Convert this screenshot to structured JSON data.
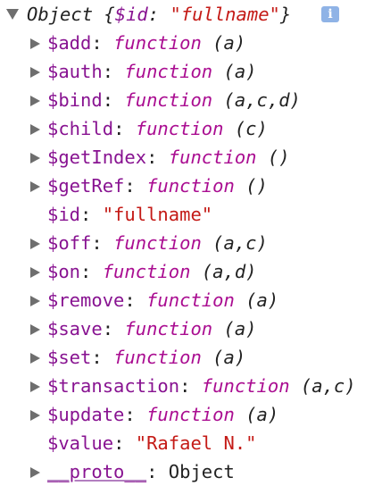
{
  "header": {
    "type_label": "Object",
    "open_brace": "{",
    "preview_key": "$id",
    "preview_sep": ": ",
    "preview_value": "\"fullname\"",
    "close_brace": "}",
    "info_icon": "i"
  },
  "properties": [
    {
      "key": "$add",
      "kind": "function",
      "label": "function",
      "args": "(a)"
    },
    {
      "key": "$auth",
      "kind": "function",
      "label": "function",
      "args": "(a)"
    },
    {
      "key": "$bind",
      "kind": "function",
      "label": "function",
      "args": "(a,c,d)"
    },
    {
      "key": "$child",
      "kind": "function",
      "label": "function",
      "args": "(c)"
    },
    {
      "key": "$getIndex",
      "kind": "function",
      "label": "function",
      "args": "()"
    },
    {
      "key": "$getRef",
      "kind": "function",
      "label": "function",
      "args": "()"
    },
    {
      "key": "$id",
      "kind": "string",
      "value": "\"fullname\""
    },
    {
      "key": "$off",
      "kind": "function",
      "label": "function",
      "args": "(a,c)"
    },
    {
      "key": "$on",
      "kind": "function",
      "label": "function",
      "args": "(a,d)"
    },
    {
      "key": "$remove",
      "kind": "function",
      "label": "function",
      "args": "(a)"
    },
    {
      "key": "$save",
      "kind": "function",
      "label": "function",
      "args": "(a)"
    },
    {
      "key": "$set",
      "kind": "function",
      "label": "function",
      "args": "(a)"
    },
    {
      "key": "$transaction",
      "kind": "function",
      "label": "function",
      "args": "(a,c)"
    },
    {
      "key": "$update",
      "kind": "function",
      "label": "function",
      "args": "(a)"
    },
    {
      "key": "$value",
      "kind": "string",
      "value": "\"Rafael N.\""
    }
  ],
  "proto": {
    "key": "__proto__",
    "value": "Object"
  },
  "colors": {
    "key": "#881391",
    "function_keyword": "#aa0d91",
    "string": "#c41a16",
    "text": "#222222",
    "arrow": "#6e6e6e",
    "info_badge": "#8fb3e6"
  }
}
